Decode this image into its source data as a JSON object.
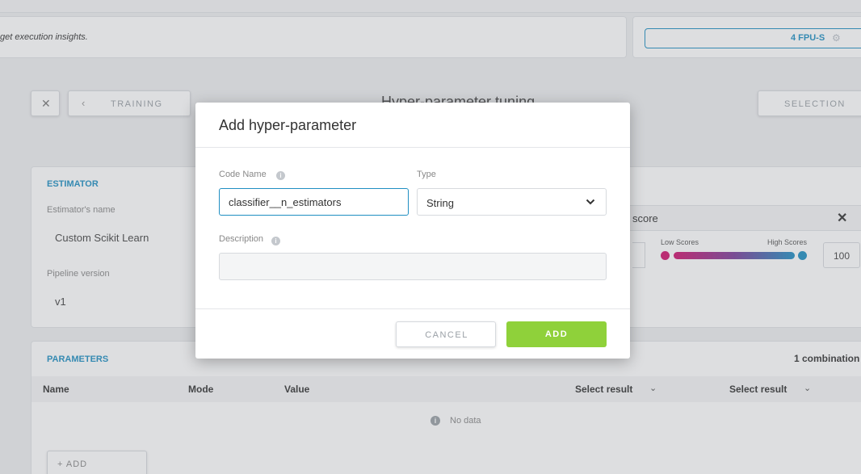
{
  "header": {
    "insights_text": "get execution insights.",
    "fpu_label": "4 FPU-S"
  },
  "toolbar": {
    "training_label": "TRAINING",
    "page_title": "Hyper-parameter tuning",
    "selection_label": "SELECTION"
  },
  "estimator": {
    "section_title": "ESTIMATOR",
    "name_label": "Estimator's name",
    "name_value": "Custom Scikit Learn",
    "pipeline_label": "Pipeline version",
    "pipeline_value": "v1"
  },
  "score": {
    "metric_text": "score",
    "low_label": "Low Scores",
    "high_label": "High Scores",
    "max_value": "100",
    "colors": {
      "low": "#d0146e",
      "high": "#1f8fc2"
    }
  },
  "parameters": {
    "section_title": "PARAMETERS",
    "combinations": "1 combination",
    "columns": [
      "Name",
      "Mode",
      "Value",
      "Select result",
      "Select result"
    ],
    "empty_text": "No data",
    "add_label": "+ ADD"
  },
  "modal": {
    "title": "Add hyper-parameter",
    "code_name_label": "Code Name",
    "code_name_value": "classifier__n_estimators",
    "type_label": "Type",
    "type_value": "String",
    "description_label": "Description",
    "description_value": "",
    "cancel_label": "CANCEL",
    "add_label": "ADD"
  },
  "colors": {
    "accent": "#1f8fc2",
    "add_button": "#8fd13a"
  }
}
